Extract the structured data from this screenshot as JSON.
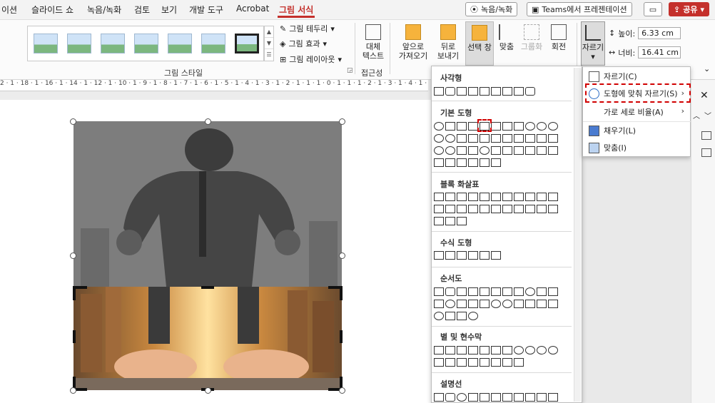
{
  "tabs": [
    "이션",
    "슬라이드 쇼",
    "녹음/녹화",
    "검토",
    "보기",
    "개발 도구",
    "Acrobat",
    "그림 서식"
  ],
  "topbar": {
    "record_label": "녹음/녹화",
    "teams_label": "Teams에서 프레젠테이션",
    "share_label": "공유"
  },
  "ribbon": {
    "border_label": "그림 테두리",
    "effects_label": "그림 효과",
    "layout_label": "그림 레이아웃",
    "styles_group": "그림 스타일",
    "alt_text_label": "대체\n텍스트",
    "accessibility_group": "접근성",
    "bring_forward": "앞으로\n가져오기",
    "send_backward": "뒤로\n보내기",
    "selection_pane": "선택 창",
    "align": "맞춤",
    "group": "그룹화",
    "rotate": "회전",
    "crop": "자르기",
    "height_label": "높이:",
    "height_value": "6.33 cm",
    "width_label": "너비:",
    "width_value": "16.41 cm"
  },
  "ruler": "2 · 1 · 18 · 1 · 16 · 1 · 14 · 1 · 12 · 1 · 10 · 1 · 9 · 1 · 8 · 1 · 7 · 1 · 6 · 1 · 5 · 1 · 4 · 1 · 3 · 1 · 2 · 1 · 1 · 1 · 0 · 1 · 1 · 1 · 2 · 1 · 3 · 1 · 4 · 1 · 5 · 1 · 6 · 1",
  "shapes_menu": {
    "rect": "사각형",
    "basic": "기본 도형",
    "arrows": "블록 화살표",
    "equation": "수식 도형",
    "flowchart": "순서도",
    "stars": "별 및 현수막",
    "callouts": "설명선"
  },
  "crop_menu": {
    "crop": "자르기(C)",
    "crop_to_shape": "도형에 맞춰 자르기(S)",
    "aspect_ratio": "가로 세로 비율(A)",
    "fill": "채우기(L)",
    "fit": "맞춤(I)"
  },
  "colors": {
    "accent": "#c4302b",
    "highlight": "#d10000"
  }
}
